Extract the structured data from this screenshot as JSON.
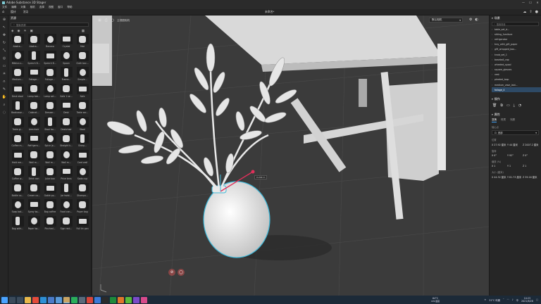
{
  "app": {
    "title": "Adobe Substance 3D Stager",
    "document": "未命名*",
    "window_controls": [
      "—",
      "☐",
      "✕"
    ]
  },
  "menu": [
    "文件",
    "编辑",
    "对象",
    "相机",
    "选择",
    "视图",
    "窗口",
    "帮助"
  ],
  "tabs": [
    "设计",
    "渲染"
  ],
  "assets": {
    "header": "资源",
    "search_placeholder": "搜索资源",
    "items": [
      "Abstra...",
      "Abstra...",
      "Banana",
      "Crystal",
      "Mat",
      "Möbius s...",
      "Speech B...",
      "Speech B...",
      "Spoon",
      "Cloth bac...",
      "Medium...",
      "Foliage...",
      "Foliage...",
      "Frame...",
      "Simple...",
      "Desk stool",
      "Lamp tab...",
      "Lamp set...",
      "Sofa 1 se...",
      "Sofa",
      "Bookcase...",
      "Cabinet...",
      "Dresser...",
      "Desk",
      "Table ser...",
      "Table gl...",
      "Armchair",
      "Stool ba...",
      "Deskchair",
      "Stool",
      "Coffee m...",
      "Refrigera...",
      "Spice ja...",
      "Straight k...",
      "Sharp...",
      "Hold me...",
      "Wall m...",
      "Wall m...",
      "Wall m...",
      "Card wall",
      "Coffee w...",
      "Drink can",
      "Juice box",
      "Price tens",
      "Soda cup",
      "Bottle co...",
      "Cream co...",
      "Gable po...",
      "Jar twist...",
      "Shampo...",
      "Soap bot...",
      "Spray bo...",
      "Bag coffee",
      "Food can...",
      "Paper bag",
      "Bag with...",
      "Paper ba...",
      "Pinched...",
      "Sign rect...",
      "Foil tin pan"
    ]
  },
  "viewport": {
    "view_label": "主视图相机",
    "camera_select": "默认相机",
    "dimension_label": "0.244 m"
  },
  "scene": {
    "header": "场景",
    "search_placeholder": "搜索场景",
    "items": [
      "table_set_d...",
      "sitting_furniture",
      "refrigerator",
      "tray_with_gift_paper",
      "gift_wrapped_box...",
      "knob_set_1",
      "baseball_cap",
      "wheeled_spool",
      "square_glasses",
      "vest",
      "pleated_loop",
      "medium_vase_laid...",
      "foliage_4"
    ],
    "selected_index": 12
  },
  "actions_header": "操作",
  "properties": {
    "header": "属性",
    "tabs": [
      "变换",
      "材质",
      "光照"
    ],
    "pivot_label": "轴心点",
    "pivot_value": "底部",
    "position_label": "位置",
    "position": [
      "X 27.92 厘米",
      "Y 44 厘米",
      "Z 2007.2 厘米"
    ],
    "rotation_label": "旋转",
    "rotation": [
      "X 0°",
      "Y 92°",
      "Z 0°"
    ],
    "scale_label": "缩放 (%)",
    "scale": [
      "X 1",
      "Y 1",
      "Z 1"
    ],
    "size_label": "大小 (厘米)",
    "size": [
      "X 44.32 厘米",
      "Y 81.73 厘米",
      "Z 39.16 厘米"
    ]
  },
  "taskbar": {
    "weather": "31°C 晴朗",
    "ime": "中",
    "time": "10:23",
    "date": "2021/6/28",
    "cpu_temp": "64°C",
    "cpu_label": "CPU温度"
  },
  "colors": {
    "accent": "#3c9cf0",
    "selection_outline": "#3fb8d8",
    "gizmo": "#e0305a",
    "viewport_floor": "#3a3a3a",
    "panel": "#262626"
  }
}
